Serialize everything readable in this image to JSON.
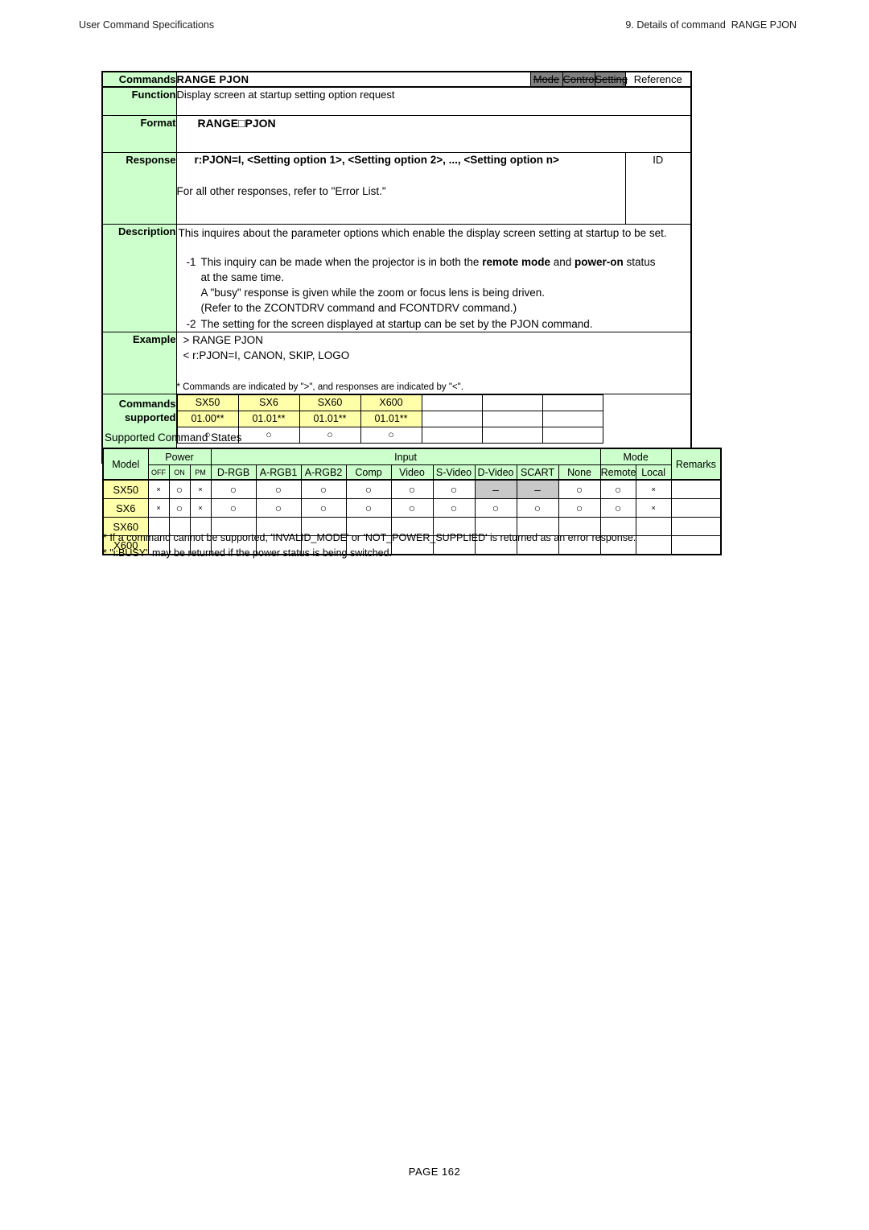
{
  "header": {
    "left": "User Command Specifications",
    "right": "9. Details of command  RANGE PJON"
  },
  "command": {
    "label_commands": "Commands",
    "title": "RANGE PJON",
    "tags": [
      {
        "label": "Mode",
        "active": false
      },
      {
        "label": "Control",
        "active": false
      },
      {
        "label": "Setting",
        "active": false
      },
      {
        "label": "Reference",
        "active": true
      }
    ],
    "label_function": "Function",
    "function_text": "Display screen at startup setting option request",
    "label_format": "Format",
    "format_text": "RANGE□PJON",
    "label_response": "Response",
    "response_line1": "r:PJON=I, <Setting option 1>, <Setting option 2>, ..., <Setting option n>",
    "response_line2": "For all other responses, refer to \"Error List.\"",
    "response_id": "ID",
    "label_description": "Description",
    "description_intro": "This inquires about the parameter options which enable the display screen setting at startup to be set.",
    "description_items": [
      {
        "num": "-1",
        "text": "This inquiry can be made when the projector is in both the ",
        "bold1": "remote mode",
        "mid": " and ",
        "bold2": "power-on",
        "tail": " status",
        "subs": [
          "at the same time.",
          "A \"busy\" response is given while the zoom or focus lens is being driven.",
          "(Refer to the ZCONTDRV command and FCONTDRV command.)"
        ]
      },
      {
        "num": "-2",
        "text": "The setting for the screen displayed at startup can be set by the PJON command.",
        "subs": []
      }
    ],
    "label_example": "Example",
    "example_lines": [
      "> RANGE PJON",
      "< r:PJON=I, CANON, SKIP, LOGO"
    ],
    "example_note": "* Commands are indicated by \">\", and responses are indicated by \"<\".",
    "label_supported_1": "Commands",
    "label_supported_2": "supported",
    "supported_models": [
      "SX50",
      "SX6",
      "SX60",
      "X600",
      "",
      "",
      ""
    ],
    "supported_versions": [
      "01.00**",
      "01.01**",
      "01.01**",
      "01.01**",
      "",
      "",
      ""
    ],
    "supported_marks": [
      "○",
      "○",
      "○",
      "○",
      "",
      "",
      ""
    ]
  },
  "states": {
    "caption": "Supported Command States",
    "header_groups": [
      {
        "label": "Model",
        "span": 1
      },
      {
        "label": "Power",
        "span": 3
      },
      {
        "label": "Input",
        "span": 8
      },
      {
        "label": "Mode",
        "span": 2
      },
      {
        "label": "Remarks",
        "span": 1
      }
    ],
    "header_sub": [
      "OFF",
      "ON",
      "PM",
      "D-RGB",
      "A-RGB1",
      "A-RGB2",
      "Comp",
      "Video",
      "S-Video",
      "D-Video",
      "SCART",
      "None",
      "Remote",
      "Local"
    ],
    "rows": [
      {
        "model": "SX50",
        "model_lines": [
          "SX50"
        ],
        "cells": [
          "×",
          "○",
          "×",
          "○",
          "○",
          "○",
          "○",
          "○",
          "○",
          "–",
          "–",
          "○",
          "○",
          "×"
        ],
        "dash_cells": [
          9,
          10
        ],
        "small_cells": [
          0,
          2,
          13
        ],
        "remarks": ""
      },
      {
        "model": "SX6",
        "model_lines": [
          "SX6",
          "SX60",
          "X600"
        ],
        "cells": [
          "×",
          "○",
          "×",
          "○",
          "○",
          "○",
          "○",
          "○",
          "○",
          "○",
          "○",
          "○",
          "○",
          "×"
        ],
        "dash_cells": [],
        "small_cells": [
          0,
          2,
          13
        ],
        "remarks": ""
      }
    ],
    "footnotes": [
      "* If a command cannot be supported, 'INVALID_MODE' or 'NOT_POWER_SUPPLIED' is returned as an error response.",
      "* \"i:BUSY\" may be returned if the power status is being switched."
    ]
  },
  "footer": {
    "page": "PAGE 162"
  }
}
